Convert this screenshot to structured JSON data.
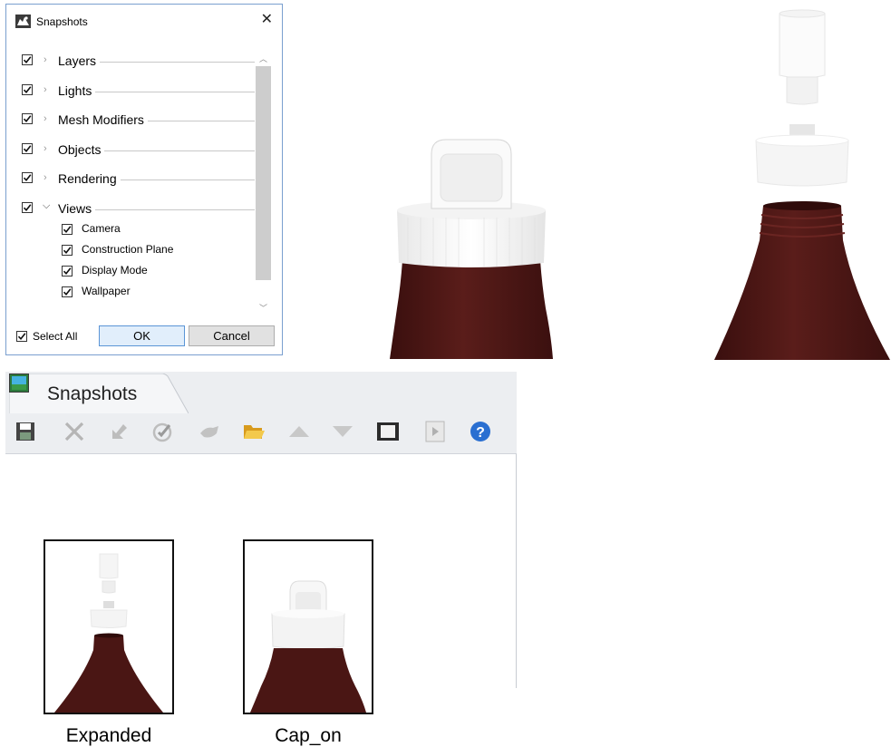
{
  "dialog": {
    "title": "Snapshots",
    "close_glyph": "✕",
    "icon": "rhino-app-icon",
    "categories": [
      {
        "label": "Layers",
        "checked": true,
        "expanded": false
      },
      {
        "label": "Lights",
        "checked": true,
        "expanded": false
      },
      {
        "label": "Mesh Modifiers",
        "checked": true,
        "expanded": false
      },
      {
        "label": "Objects",
        "checked": true,
        "expanded": false
      },
      {
        "label": "Rendering",
        "checked": true,
        "expanded": false
      },
      {
        "label": "Views",
        "checked": true,
        "expanded": true
      }
    ],
    "view_items": [
      {
        "label": "Camera",
        "checked": true
      },
      {
        "label": "Construction Plane",
        "checked": true
      },
      {
        "label": "Display Mode",
        "checked": true
      },
      {
        "label": "Wallpaper",
        "checked": true
      }
    ],
    "select_all_label": "Select All",
    "select_all_checked": true,
    "ok_label": "OK",
    "cancel_label": "Cancel"
  },
  "panel": {
    "tab_label": "Snapshots",
    "toolbar": [
      {
        "icon": "save-icon",
        "enabled": true
      },
      {
        "icon": "delete-icon",
        "enabled": false
      },
      {
        "icon": "update-icon",
        "enabled": false
      },
      {
        "icon": "restore-icon",
        "enabled": false
      },
      {
        "icon": "restore-animate-icon",
        "enabled": false
      },
      {
        "icon": "open-folder-icon",
        "enabled": true
      },
      {
        "icon": "move-up-icon",
        "enabled": false
      },
      {
        "icon": "move-down-icon",
        "enabled": false
      },
      {
        "icon": "film-icon",
        "enabled": true
      },
      {
        "icon": "play-icon",
        "enabled": false
      },
      {
        "icon": "help-icon",
        "enabled": true
      }
    ],
    "snapshots": [
      {
        "name": "Expanded",
        "selected": false
      },
      {
        "name": "Cap_on",
        "selected": false
      }
    ]
  },
  "colors": {
    "bottle": "#4a1614",
    "accent_blue": "#5b95d6",
    "help_blue": "#2a6fd1",
    "folder_yellow": "#e9b83a"
  }
}
